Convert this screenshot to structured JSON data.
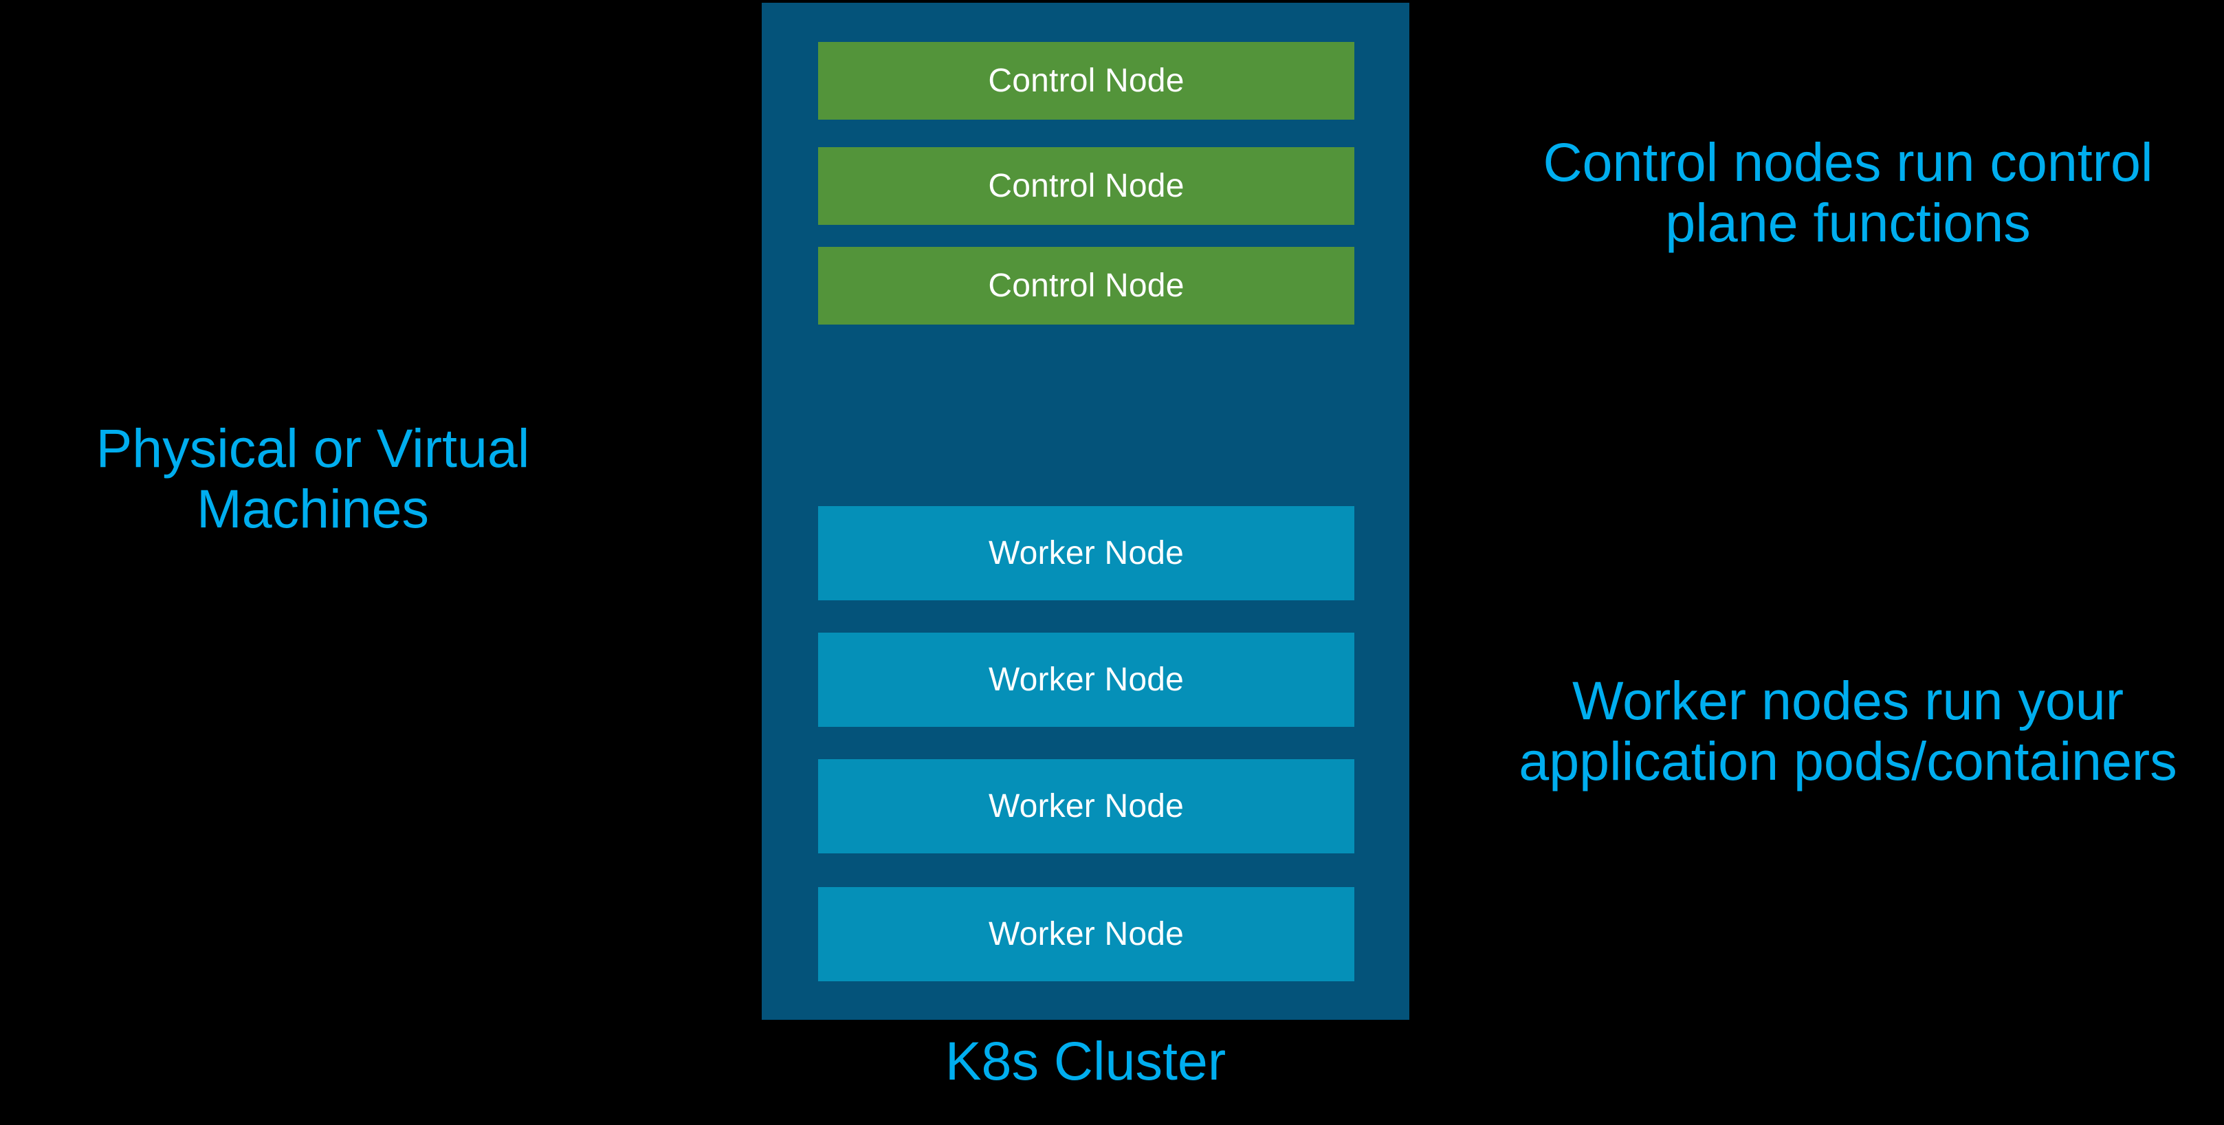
{
  "diagram": {
    "title": "K8s Cluster",
    "background_color": "#000000",
    "accent_color": "#00AEEF",
    "cluster": {
      "caption": "K8s Cluster",
      "fill_color": "#04537A",
      "control_node_color": "#53943A",
      "worker_node_color": "#0590B8",
      "node_label_color": "#FFFFFF",
      "control_nodes": [
        {
          "label": "Control Node"
        },
        {
          "label": "Control Node"
        },
        {
          "label": "Control Node"
        }
      ],
      "worker_nodes": [
        {
          "label": "Worker Node"
        },
        {
          "label": "Worker Node"
        },
        {
          "label": "Worker Node"
        },
        {
          "label": "Worker Node"
        }
      ]
    },
    "annotations": {
      "left": "Physical or Virtual Machines",
      "control": "Control nodes run control plane functions",
      "worker": "Worker nodes run your application pods/containers"
    }
  }
}
